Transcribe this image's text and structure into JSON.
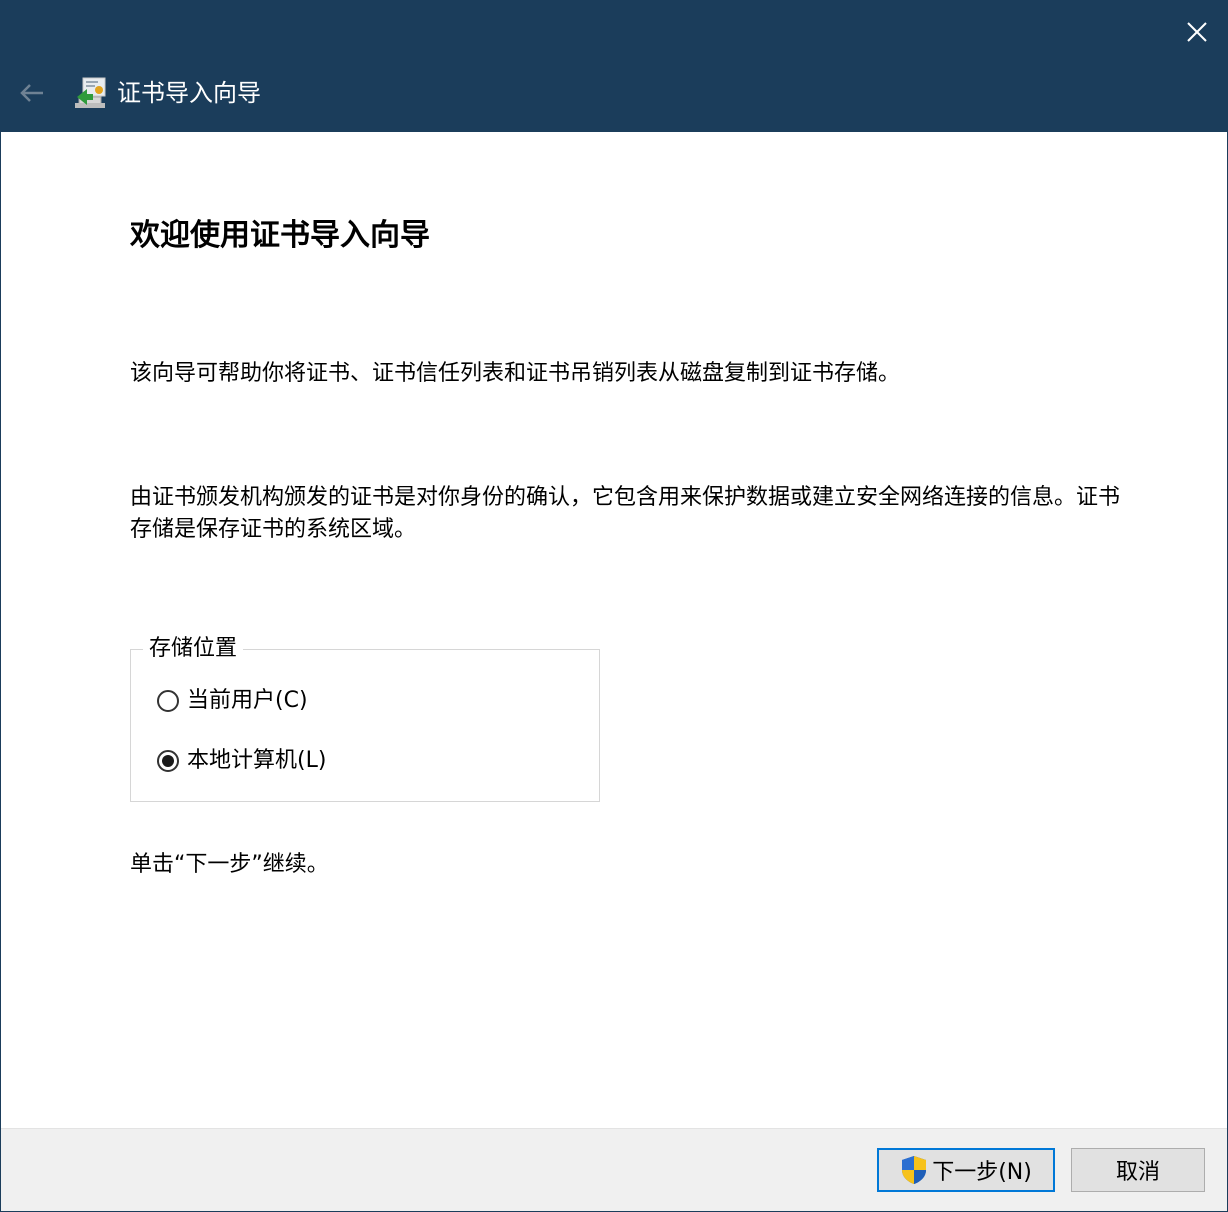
{
  "window": {
    "title": "证书导入向导"
  },
  "content": {
    "heading": "欢迎使用证书导入向导",
    "paragraph1": "该向导可帮助你将证书、证书信任列表和证书吊销列表从磁盘复制到证书存储。",
    "paragraph2": "由证书颁发机构颁发的证书是对你身份的确认，它包含用来保护数据或建立安全网络连接的信息。证书存储是保存证书的系统区域。",
    "store_location": {
      "legend": "存储位置",
      "options": [
        {
          "label": "当前用户(C)",
          "selected": false
        },
        {
          "label": "本地计算机(L)",
          "selected": true
        }
      ]
    },
    "instruction": "单击“下一步”继续。"
  },
  "footer": {
    "next_label": "下一步(N)",
    "cancel_label": "取消"
  },
  "colors": {
    "titlebar": "#1b3d5b",
    "focus_border": "#0078d7",
    "footer_bg": "#f0f0f0"
  },
  "icons": {
    "back": "arrow-left-icon",
    "close": "close-icon",
    "app": "certificate-icon",
    "next": "uac-shield-icon"
  }
}
